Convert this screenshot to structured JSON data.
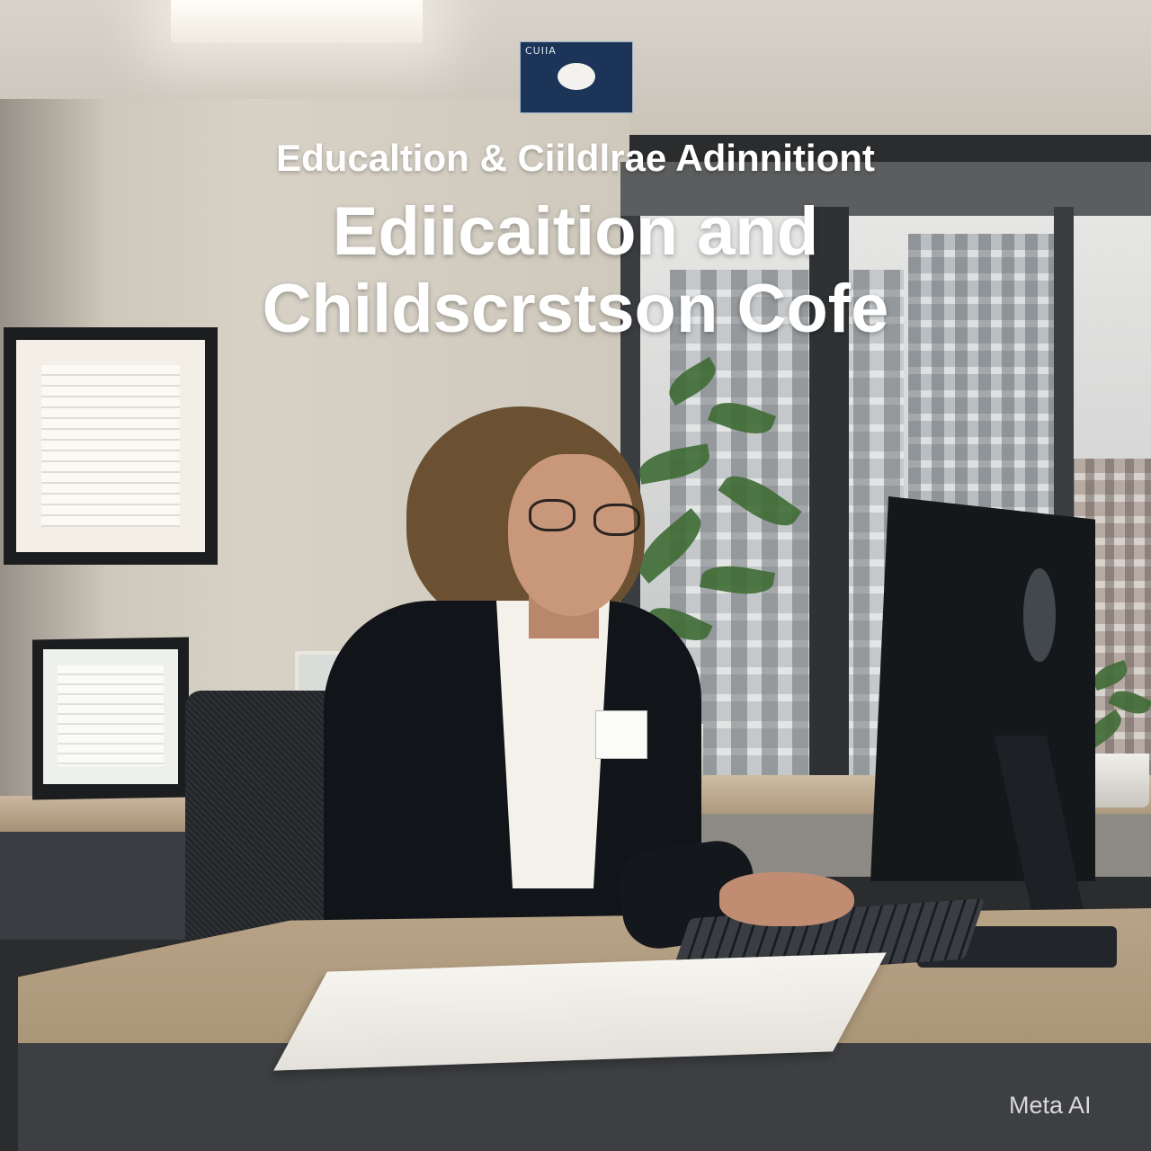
{
  "overlay": {
    "logo_text": "CUIIA",
    "subtitle": "Educaltion & Ciildlrae Adinnitiont",
    "title_line_1": "Ediicaition and",
    "title_line_2": "Childscrstson Cofe"
  },
  "watermark": {
    "text": "Meta AI"
  },
  "scene": {
    "icons": [
      "monitor-logo-icon",
      "logo-card-icon"
    ],
    "colors": {
      "jacket": "#111418",
      "hair": "#6b5132",
      "desk": "#b8a387",
      "logo_card": "#1b3457"
    }
  }
}
